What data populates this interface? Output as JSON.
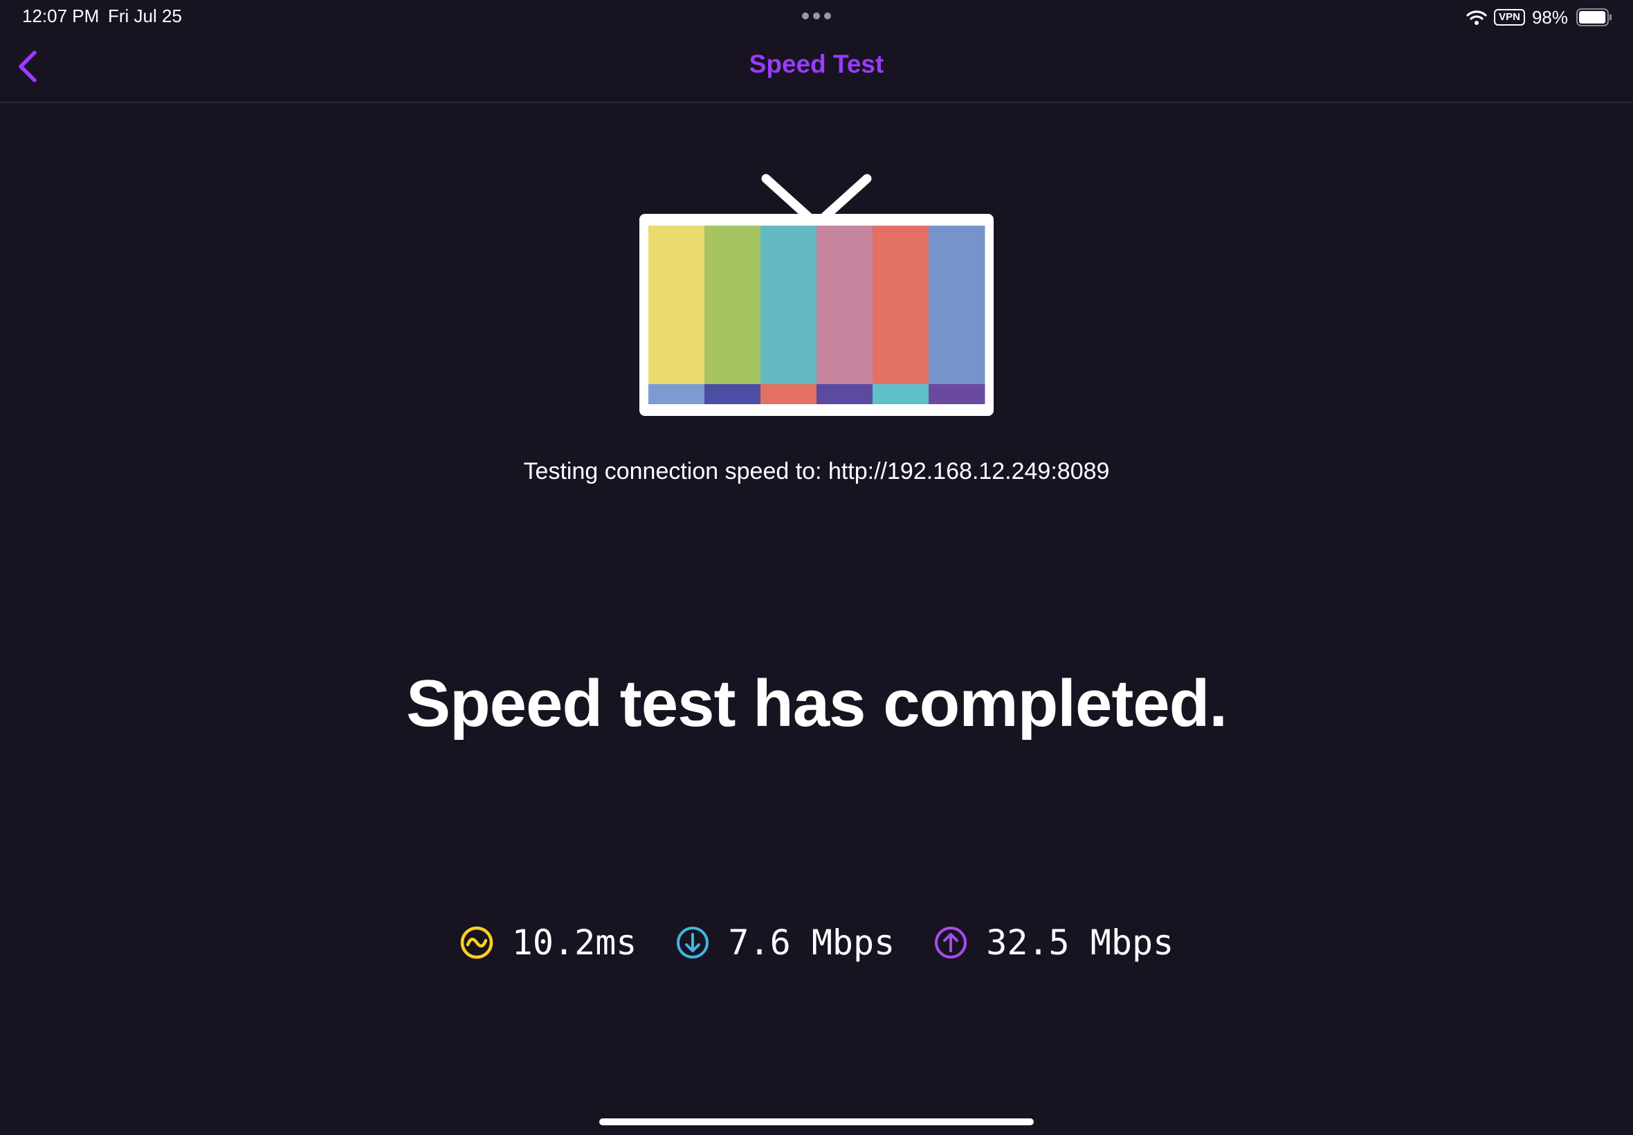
{
  "status_bar": {
    "time": "12:07 PM",
    "date": "Fri Jul 25",
    "vpn_label": "VPN",
    "battery_percent": "98%",
    "battery_level": 0.98
  },
  "nav": {
    "title": "Speed Test"
  },
  "server": {
    "text": "Testing connection speed to: http://192.168.12.249:8089"
  },
  "headline": "Speed test has completed.",
  "results": {
    "ping": "10.2ms",
    "download": "7.6 Mbps",
    "upload": "32.5 Mbps"
  },
  "colors": {
    "accent": "#9a3bff",
    "background": "#181321",
    "ping_icon": "#f7d21f",
    "download_icon": "#3cb8e0",
    "upload_icon": "#a64cf0",
    "tv_top_bars": [
      "#ebdb6f",
      "#a6c461",
      "#63b8c3",
      "#c6849f",
      "#e37064",
      "#7793cc"
    ],
    "tv_bottom_bars": [
      "#7d9bd2",
      "#4b4ea3",
      "#e46f63",
      "#5a4aa1",
      "#5ec0c8",
      "#6a4aa0"
    ]
  },
  "icons": {
    "back": "chevron-left-icon",
    "wifi": "wifi-icon",
    "battery": "battery-icon",
    "ping": "ping-icon",
    "download": "download-arrow-icon",
    "upload": "upload-arrow-icon",
    "tv": "tv-icon"
  }
}
